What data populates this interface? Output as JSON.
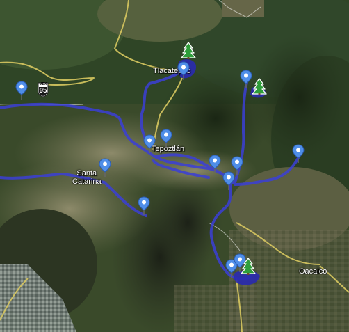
{
  "map": {
    "labels": {
      "tlacatepec": "Tlacatepec",
      "tepoztlan": "Tepoztlán",
      "santa_catarina": "Santa\nCatarina",
      "oacalco": "Oacalco"
    },
    "highway_shield": {
      "country": "MEX",
      "number": "95"
    },
    "colors": {
      "route": "#3b3fd6",
      "road_yellow": "#d8c860",
      "pin": "#4f8ee8",
      "tree": "#2e9e3a",
      "lake": "#2a2ab0"
    },
    "icons": {
      "pin": "map-pin-icon",
      "tree": "tree-icon"
    }
  }
}
